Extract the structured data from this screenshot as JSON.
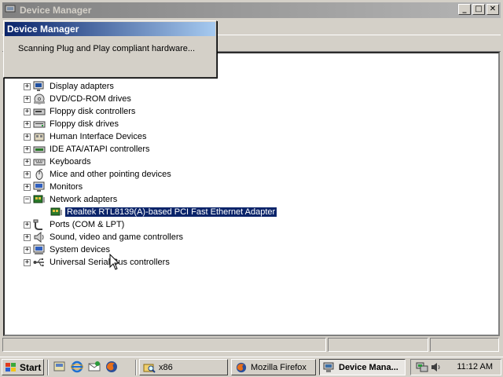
{
  "window": {
    "title": "Device Manager",
    "controls": {
      "minimize": "_",
      "maximize": "□",
      "close": "✕"
    }
  },
  "popup": {
    "title": "Device Manager",
    "message": "Scanning Plug and Play compliant hardware..."
  },
  "tree": {
    "items": [
      {
        "label": "Display adapters",
        "icon": "display-adapter-icon",
        "expander": "+"
      },
      {
        "label": "DVD/CD-ROM drives",
        "icon": "cdrom-icon",
        "expander": "+"
      },
      {
        "label": "Floppy disk controllers",
        "icon": "floppy-controller-icon",
        "expander": "+"
      },
      {
        "label": "Floppy disk drives",
        "icon": "floppy-drive-icon",
        "expander": "+"
      },
      {
        "label": "Human Interface Devices",
        "icon": "hid-icon",
        "expander": "+"
      },
      {
        "label": "IDE ATA/ATAPI controllers",
        "icon": "ide-controller-icon",
        "expander": "+"
      },
      {
        "label": "Keyboards",
        "icon": "keyboard-icon",
        "expander": "+"
      },
      {
        "label": "Mice and other pointing devices",
        "icon": "mouse-icon",
        "expander": "+"
      },
      {
        "label": "Monitors",
        "icon": "monitor-icon",
        "expander": "+"
      },
      {
        "label": "Network adapters",
        "icon": "network-adapter-icon",
        "expander": "−"
      },
      {
        "label": "Realtek RTL8139(A)-based PCI Fast Ethernet Adapter",
        "icon": "network-card-icon",
        "child": true,
        "selected": true
      },
      {
        "label": "Ports (COM & LPT)",
        "icon": "port-icon",
        "expander": "+"
      },
      {
        "label": "Sound, video and game controllers",
        "icon": "sound-icon",
        "expander": "+"
      },
      {
        "label": "System devices",
        "icon": "system-device-icon",
        "expander": "+"
      },
      {
        "label": "Universal Serial Bus controllers",
        "icon": "usb-icon",
        "expander": "+"
      }
    ]
  },
  "taskbar": {
    "start_label": "Start",
    "quick_launch": [
      "show-desktop-icon",
      "internet-explorer-icon",
      "outlook-express-icon",
      "firefox-icon"
    ],
    "tasks": [
      {
        "label": "x86",
        "icon": "folder-search-icon",
        "active": false
      },
      {
        "label": "Mozilla Firefox",
        "icon": "firefox-icon",
        "active": false
      },
      {
        "label": "Device Mana...",
        "icon": "device-manager-icon",
        "active": true
      }
    ],
    "clock": "11:12 AM"
  },
  "colors": {
    "selection": "#0a246a",
    "inactive_title": "#808080",
    "active_title": "#0a246a",
    "face": "#d4d0c8"
  }
}
